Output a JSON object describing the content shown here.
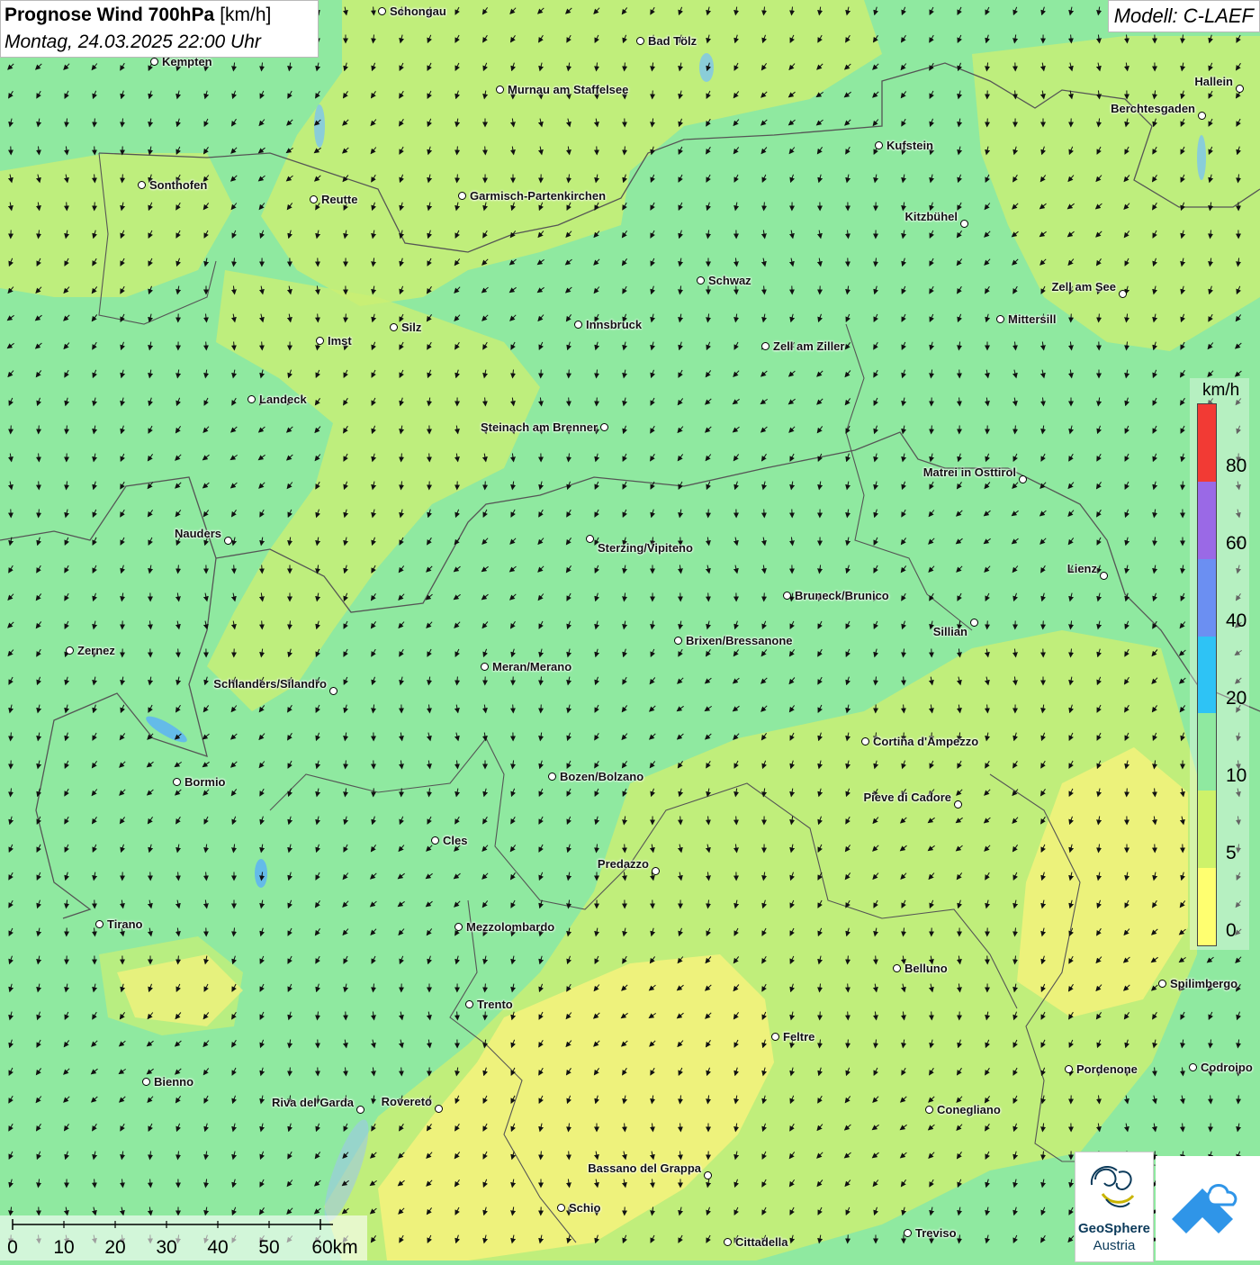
{
  "title": {
    "main": "Prognose Wind 700hPa",
    "unit": "[km/h]",
    "date": "Montag, 24.03.2025 22:00 Uhr"
  },
  "model": "Modell: C-LAEF",
  "legend": {
    "unit": "km/h",
    "labels": [
      "80",
      "60",
      "40",
      "20",
      "10",
      "5",
      "0"
    ],
    "colors": [
      "#f23a34",
      "#9a69e6",
      "#6b8ff2",
      "#2ec3f5",
      "#8fe9a0",
      "#cdf26a",
      "#ffff70"
    ]
  },
  "colors": {
    "background": "#8fe9a0",
    "yellow_green": "#cdf26a",
    "yellow": "#fbf57c",
    "border": "#555555",
    "lake": "#7cc4f0"
  },
  "scalebar": {
    "labels": [
      "0",
      "10",
      "20",
      "30",
      "40",
      "50",
      "60km"
    ]
  },
  "cities": [
    {
      "name": "Schongau"
    },
    {
      "name": "Bad Tölz"
    },
    {
      "name": "Kempten"
    },
    {
      "name": "Murnau am Staffelsee"
    },
    {
      "name": "Hallein"
    },
    {
      "name": "Berchtesgaden"
    },
    {
      "name": "Kufstein"
    },
    {
      "name": "Sonthofen"
    },
    {
      "name": "Reutte"
    },
    {
      "name": "Garmisch-Partenkirchen"
    },
    {
      "name": "Kitzbühel"
    },
    {
      "name": "Schwaz"
    },
    {
      "name": "Zell am See"
    },
    {
      "name": "Mittersill"
    },
    {
      "name": "Innsbruck"
    },
    {
      "name": "Silz"
    },
    {
      "name": "Imst"
    },
    {
      "name": "Zell am Ziller"
    },
    {
      "name": "Landeck"
    },
    {
      "name": "Steinach am Brenner"
    },
    {
      "name": "Matrei in Osttirol"
    },
    {
      "name": "Nauders"
    },
    {
      "name": "Sterzing/Vipiteno"
    },
    {
      "name": "Lienz"
    },
    {
      "name": "Bruneck/Brunico"
    },
    {
      "name": "Sillian"
    },
    {
      "name": "Brixen/Bressanone"
    },
    {
      "name": "Zernez"
    },
    {
      "name": "Meran/Merano"
    },
    {
      "name": "Schlanders/Silandro"
    },
    {
      "name": "Cortina d'Ampezzo"
    },
    {
      "name": "Bozen/Bolzano"
    },
    {
      "name": "Bormio"
    },
    {
      "name": "Pieve di Cadore"
    },
    {
      "name": "Cles"
    },
    {
      "name": "Predazzo"
    },
    {
      "name": "Tirano"
    },
    {
      "name": "Mezzolombardo"
    },
    {
      "name": "Belluno"
    },
    {
      "name": "Spilimbergo"
    },
    {
      "name": "Trento"
    },
    {
      "name": "Feltre"
    },
    {
      "name": "Pordenone"
    },
    {
      "name": "Codroipo"
    },
    {
      "name": "Bienno"
    },
    {
      "name": "Riva del Garda"
    },
    {
      "name": "Rovereto"
    },
    {
      "name": "Conegliano"
    },
    {
      "name": "Bassano del Grappa"
    },
    {
      "name": "Schio"
    },
    {
      "name": "Treviso"
    },
    {
      "name": "Cittadella"
    }
  ],
  "logo": {
    "name": "GeoSphere",
    "sub": "Austria"
  },
  "icons": {
    "app_logo": "mountain-cloud-icon",
    "geosphere_logo": "geosphere-swirl-icon",
    "city_marker": "circle-marker-icon",
    "wind_arrow": "arrow-icon"
  }
}
